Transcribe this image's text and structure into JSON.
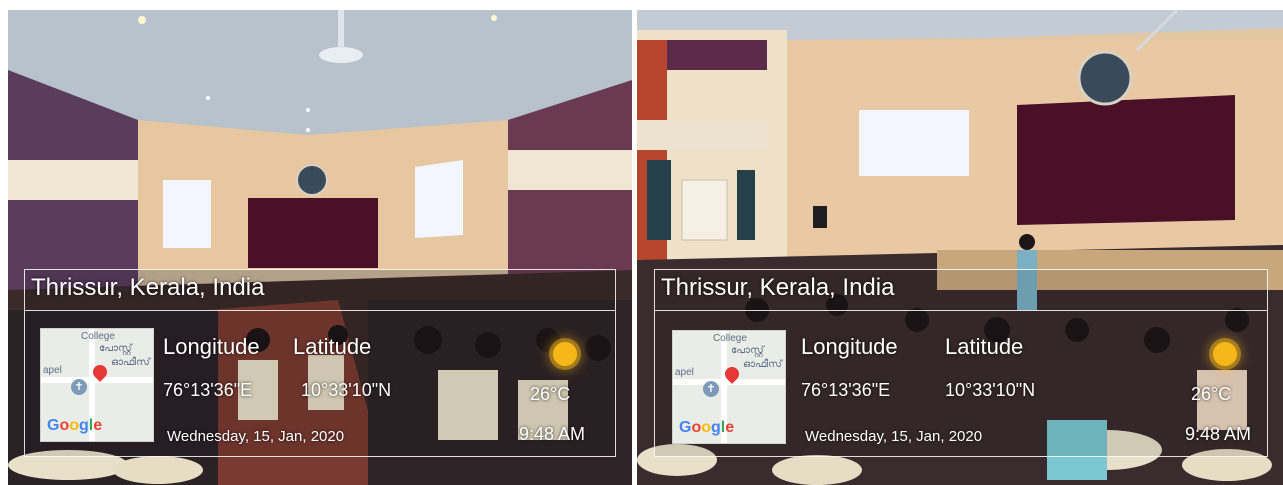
{
  "photos": [
    {
      "location": "Thrissur, Kerala, India",
      "longitude_label": "Longitude",
      "latitude_label": "Latitude",
      "longitude": "76°13'36\"E",
      "latitude": "10°33'10\"N",
      "temperature": "26°C",
      "date": "Wednesday, 15, Jan, 2020",
      "time": "9:48 AM",
      "map": {
        "poi": "College",
        "poi_local": "പോസ്റ്റ്",
        "poi_local2": "ഓഫീസ് 6",
        "chapel": "apel",
        "logo": "Google"
      }
    },
    {
      "location": "Thrissur, Kerala, India",
      "longitude_label": "Longitude",
      "latitude_label": "Latitude",
      "longitude": "76°13'36\"E",
      "latitude": "10°33'10\"N",
      "temperature": "26°C",
      "date": "Wednesday, 15, Jan, 2020",
      "time": "9:48 AM",
      "map": {
        "poi": "College",
        "poi_local": "പോസ്റ്റ്",
        "poi_local2": "ഓഫീസ് 6",
        "chapel": "apel",
        "logo": "Google"
      }
    }
  ],
  "colors": {
    "curtain": "#5a1430",
    "wall": "#e8c9a2",
    "ceiling": "#b9c3cf",
    "floor": "#7a3a32",
    "screen": "#f4f6ff"
  }
}
